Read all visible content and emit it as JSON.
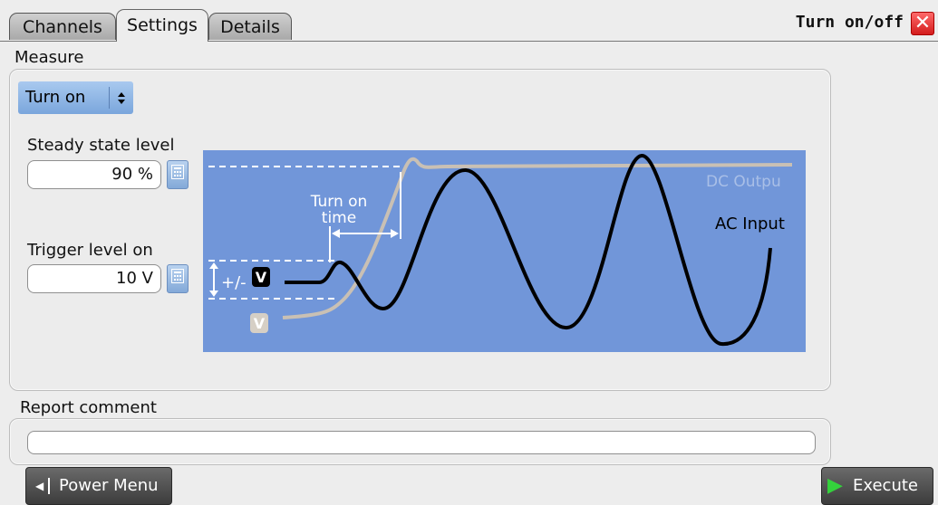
{
  "tabs": [
    {
      "label": "Channels",
      "active": false
    },
    {
      "label": "Settings",
      "active": true
    },
    {
      "label": "Details",
      "active": false
    }
  ],
  "dialog": {
    "title": "Turn on/off",
    "close_icon": "close-icon"
  },
  "measure": {
    "label": "Measure",
    "mode_selected": "Turn on",
    "steady_state_label": "Steady state level",
    "steady_state_value": "90 %",
    "trigger_label": "Trigger level on",
    "trigger_value": "10 V"
  },
  "diagram": {
    "turn_on_time_line1": "Turn on",
    "turn_on_time_line2": "time",
    "dc_output_label": "DC Outpu",
    "ac_input_label": "AC Input",
    "plus_minus": "+/-",
    "v_badge": "V",
    "v_badge_light": "V",
    "colors": {
      "background": "#7196d9",
      "dc_curve": "#c9c0b4",
      "ac_curve": "#000000",
      "guides": "#ffffff"
    }
  },
  "report": {
    "label": "Report comment",
    "value": ""
  },
  "buttons": {
    "power_menu": "Power Menu",
    "execute": "Execute"
  }
}
